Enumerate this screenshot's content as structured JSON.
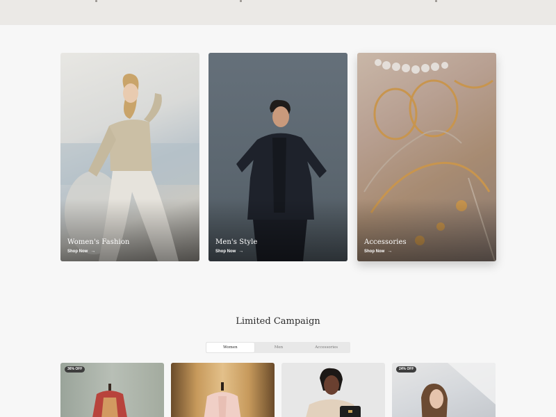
{
  "categories": [
    {
      "title": "Women's Fashion",
      "cta": "Shop Now",
      "cta_icon": "arrow-right-icon"
    },
    {
      "title": "Men's Style",
      "cta": "Shop Now",
      "cta_icon": "arrow-right-icon"
    },
    {
      "title": "Accessories",
      "cta": "Shop Now",
      "cta_icon": "arrow-right-icon"
    }
  ],
  "campaign": {
    "title": "Limited Campaign",
    "tabs": [
      "Women",
      "Men",
      "Accessories"
    ],
    "active_tab": "Women",
    "products": [
      {
        "badge": "36% OFF"
      },
      {
        "badge": ""
      },
      {
        "badge": ""
      },
      {
        "badge": "24% OFF"
      }
    ]
  }
}
